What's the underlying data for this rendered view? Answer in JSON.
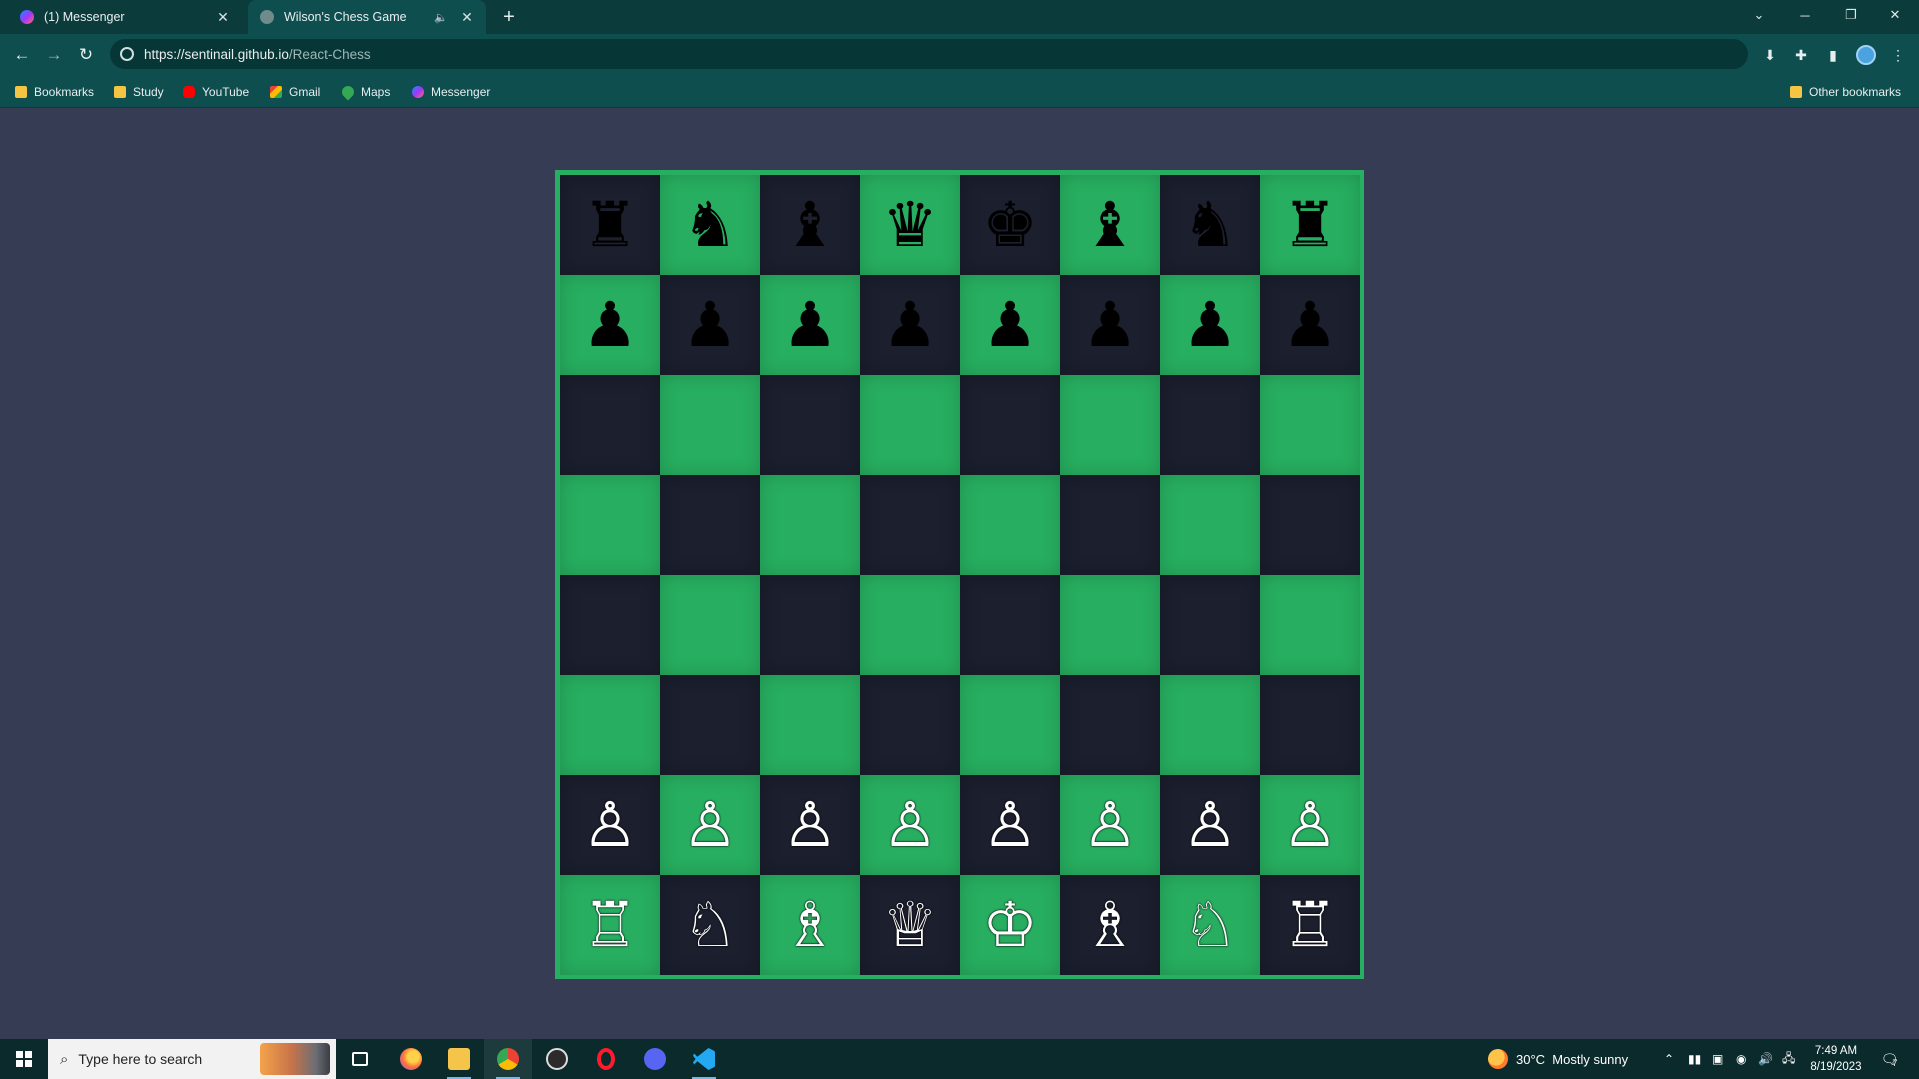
{
  "browser": {
    "tabs": [
      {
        "title": "(1) Messenger",
        "favicon": "messenger-icon"
      },
      {
        "title": "Wilson's Chess Game",
        "favicon": "globe-icon",
        "audio": "speaker-icon"
      }
    ],
    "url_host": "https://sentinail.github.io",
    "url_path": "/React-Chess",
    "bookmarks": [
      {
        "label": "Bookmarks",
        "icon": "folder-icon"
      },
      {
        "label": "Study",
        "icon": "folder-icon"
      },
      {
        "label": "YouTube",
        "icon": "youtube-icon"
      },
      {
        "label": "Gmail",
        "icon": "gmail-icon"
      },
      {
        "label": "Maps",
        "icon": "maps-icon"
      },
      {
        "label": "Messenger",
        "icon": "messenger-icon"
      }
    ],
    "other_bookmarks": "Other bookmarks"
  },
  "board": {
    "colors": {
      "light": "#27ae60",
      "dark": "#1b1f2e",
      "page": "#353c53"
    },
    "rows": [
      [
        {
          "color": "black",
          "piece": "rook"
        },
        {
          "color": "black",
          "piece": "knight"
        },
        {
          "color": "black",
          "piece": "bishop"
        },
        {
          "color": "black",
          "piece": "queen"
        },
        {
          "color": "black",
          "piece": "king"
        },
        {
          "color": "black",
          "piece": "bishop"
        },
        {
          "color": "black",
          "piece": "knight"
        },
        {
          "color": "black",
          "piece": "rook"
        }
      ],
      [
        {
          "color": "black",
          "piece": "pawn"
        },
        {
          "color": "black",
          "piece": "pawn"
        },
        {
          "color": "black",
          "piece": "pawn"
        },
        {
          "color": "black",
          "piece": "pawn"
        },
        {
          "color": "black",
          "piece": "pawn"
        },
        {
          "color": "black",
          "piece": "pawn"
        },
        {
          "color": "black",
          "piece": "pawn"
        },
        {
          "color": "black",
          "piece": "pawn"
        }
      ],
      [
        null,
        null,
        null,
        null,
        null,
        null,
        null,
        null
      ],
      [
        null,
        null,
        null,
        null,
        null,
        null,
        null,
        null
      ],
      [
        null,
        null,
        null,
        null,
        null,
        null,
        null,
        null
      ],
      [
        null,
        null,
        null,
        null,
        null,
        null,
        null,
        null
      ],
      [
        {
          "color": "white",
          "piece": "pawn"
        },
        {
          "color": "white",
          "piece": "pawn"
        },
        {
          "color": "white",
          "piece": "pawn"
        },
        {
          "color": "white",
          "piece": "pawn"
        },
        {
          "color": "white",
          "piece": "pawn"
        },
        {
          "color": "white",
          "piece": "pawn"
        },
        {
          "color": "white",
          "piece": "pawn"
        },
        {
          "color": "white",
          "piece": "pawn"
        }
      ],
      [
        {
          "color": "white",
          "piece": "rook"
        },
        {
          "color": "white",
          "piece": "knight"
        },
        {
          "color": "white",
          "piece": "bishop"
        },
        {
          "color": "white",
          "piece": "queen"
        },
        {
          "color": "white",
          "piece": "king"
        },
        {
          "color": "white",
          "piece": "bishop"
        },
        {
          "color": "white",
          "piece": "knight"
        },
        {
          "color": "white",
          "piece": "rook"
        }
      ]
    ]
  },
  "taskbar": {
    "search_placeholder": "Type here to search",
    "apps": [
      "task-view-icon",
      "firefox-icon",
      "file-explorer-icon",
      "chrome-icon",
      "obs-icon",
      "opera-icon",
      "discord-icon",
      "vscode-icon"
    ],
    "weather_temp": "30°C",
    "weather_desc": "Mostly sunny",
    "time": "7:49 AM",
    "date": "8/19/2023",
    "notification_count": "7"
  }
}
